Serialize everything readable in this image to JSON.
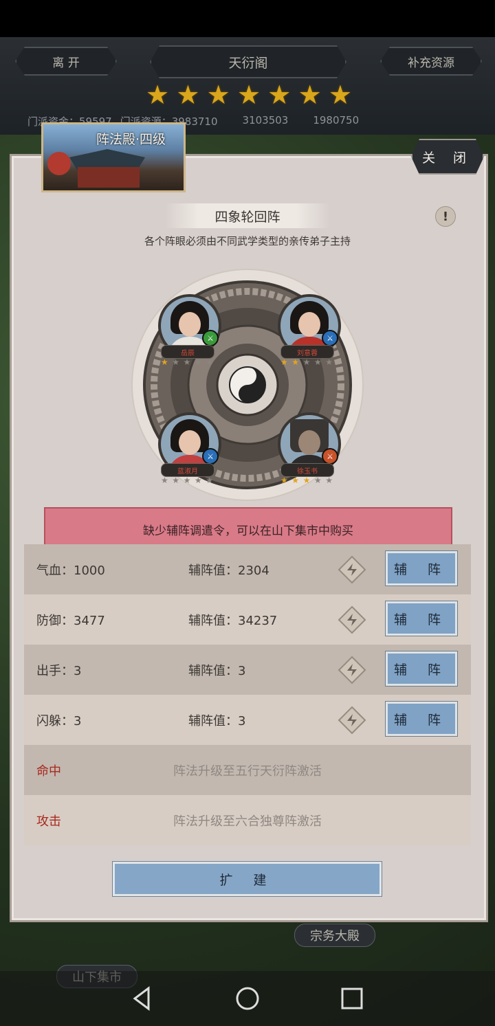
{
  "topbar": {
    "leave_label": "离 开",
    "title": "天衍阁",
    "supply_label": "补充资源",
    "star_count": 7,
    "resources": [
      "门派资金：59597",
      "门派资源：3983710",
      "3103503",
      "1980750"
    ]
  },
  "building": {
    "title": "阵法殿·四级",
    "close_label": "关 闭"
  },
  "formation": {
    "name": "四象轮回阵",
    "subtitle": "各个阵眼必须由不同武学类型的亲传弟子主持",
    "info_glyph": "!"
  },
  "heroes": [
    {
      "name": "岳辰",
      "stars": 1,
      "max_stars": 5,
      "type_color": "#3a9a3a"
    },
    {
      "name": "刘意蓉",
      "stars": 2,
      "max_stars": 5,
      "type_color": "#2a6fb8"
    },
    {
      "name": "蓝淑月",
      "stars": 0,
      "max_stars": 5,
      "type_color": "#2a6fb8"
    },
    {
      "name": "徐玉书",
      "stars": 3,
      "max_stars": 5,
      "type_color": "#c8522a"
    }
  ],
  "warning": "缺少辅阵调遣令，可以在山下集市中购买",
  "stats": [
    {
      "label": "气血：1000",
      "assist": "辅阵值：2304",
      "button": "辅 阵"
    },
    {
      "label": "防御：3477",
      "assist": "辅阵值：34237",
      "button": "辅 阵"
    },
    {
      "label": "出手：3",
      "assist": "辅阵值：3",
      "button": "辅 阵"
    },
    {
      "label": "闪躲：3",
      "assist": "辅阵值：3",
      "button": "辅 阵"
    }
  ],
  "locked": [
    {
      "label": "命中",
      "text": "阵法升级至五行天衍阵激活"
    },
    {
      "label": "攻击",
      "text": "阵法升级至六合独尊阵激活"
    }
  ],
  "build_label": "扩 建",
  "map_labels": {
    "hall": "宗务大殿",
    "market": "山下集市"
  },
  "colors": {
    "accent_button": "#7fa2c5",
    "warning_bg": "#d87a87",
    "locked_red": "#a8281e",
    "star_gold": "#e0a41e"
  }
}
